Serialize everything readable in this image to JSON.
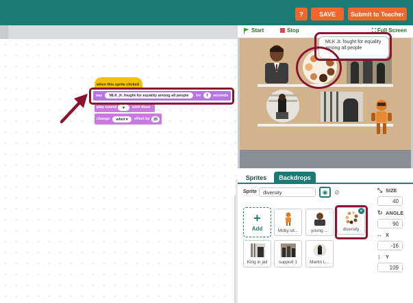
{
  "toolbar": {
    "help_label": "?",
    "save_label": "SAVE",
    "submit_label": "Submit to Teacher"
  },
  "stage_controls": {
    "start_label": "Start",
    "stop_label": "Stop",
    "fullscreen_label": "Full Screen"
  },
  "blocks": {
    "hat": "when this sprite clicked",
    "say_prefix": "say",
    "say_text": "MLK Jr. fought for equality among all people",
    "say_for": "for",
    "say_secs": "7",
    "say_suffix": "seconds",
    "sound_prefix": "play sound",
    "sound_suffix": "until done",
    "change_prefix": "change",
    "change_effect": "whirl",
    "change_by": "effect by",
    "change_value": "25"
  },
  "stage": {
    "bubble_text": "MLK Jr. fought for equality among all people"
  },
  "tabs": {
    "sprites": "Sprites",
    "backdrops": "Backdrops"
  },
  "sprite_info": {
    "label": "Sprite",
    "name": "diversity"
  },
  "properties": {
    "size_label": "SIZE",
    "size_value": "40",
    "angle_label": "ANGLE",
    "angle_value": "90",
    "x_label": "X",
    "x_value": "-16",
    "y_label": "Y",
    "y_value": "109"
  },
  "sprites": {
    "add_label": "Add",
    "items": [
      {
        "name": "Moby sit..."
      },
      {
        "name": "young ..."
      },
      {
        "name": "diversity"
      },
      {
        "name": "King in jail"
      },
      {
        "name": "support 1"
      },
      {
        "name": "Martin L..."
      }
    ]
  },
  "colors": {
    "topbar": "#1e7a74",
    "button": "#f0662e",
    "highlight": "#8a1330",
    "looks_block": "#b873e6",
    "events_block": "#f4c200"
  }
}
